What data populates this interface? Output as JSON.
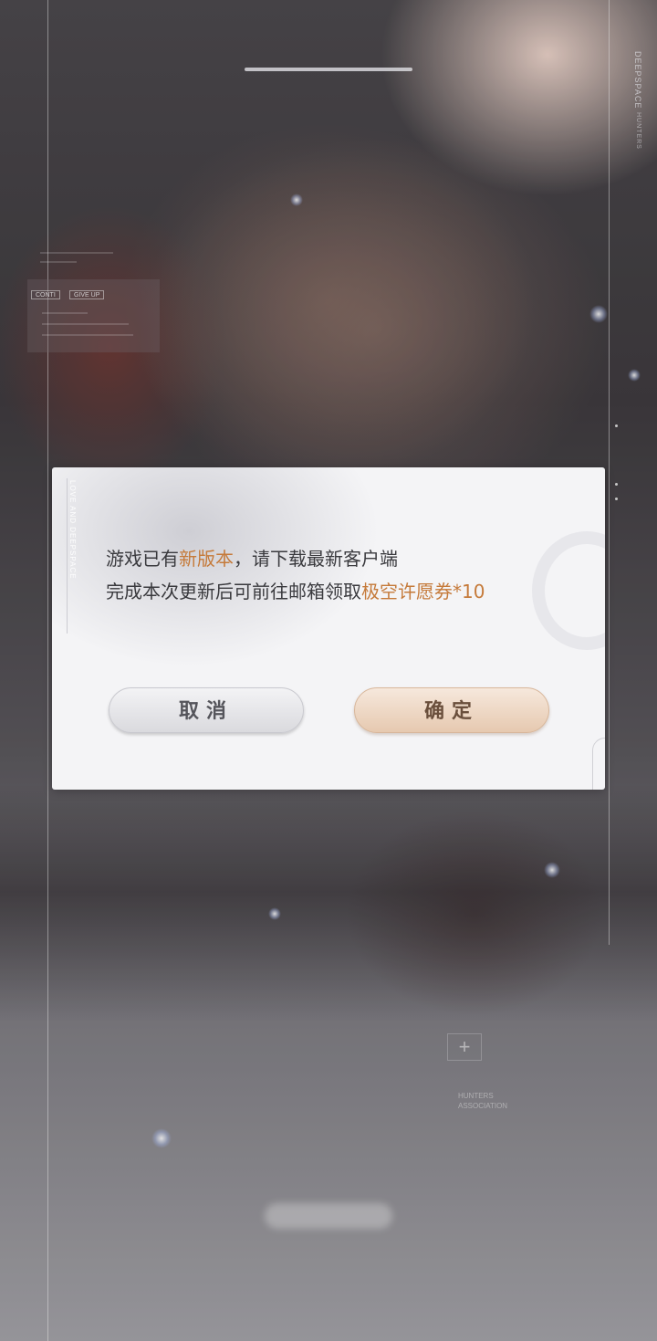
{
  "background": {
    "brand_title": "DEEPSPACE",
    "brand_subtitle": "HUNTERS",
    "hud_tags": [
      "CONTI",
      "GIVE UP"
    ],
    "hunters_label": "HUNTERS\nASSOCIATION"
  },
  "dialog": {
    "side_text": "LOVE AND DEEPSPACE",
    "line1_pre": "游戏已有",
    "line1_highlight": "新版本",
    "line1_post": "，请下载最新客户端",
    "line2_pre": "完成本次更新后可前往邮箱领取",
    "line2_highlight": "极空许愿券*10",
    "cancel_label": "取消",
    "confirm_label": "确定"
  },
  "colors": {
    "highlight": "#c57a3a",
    "text": "#3a3a3e",
    "dialog_bg": "#f4f4f6"
  }
}
